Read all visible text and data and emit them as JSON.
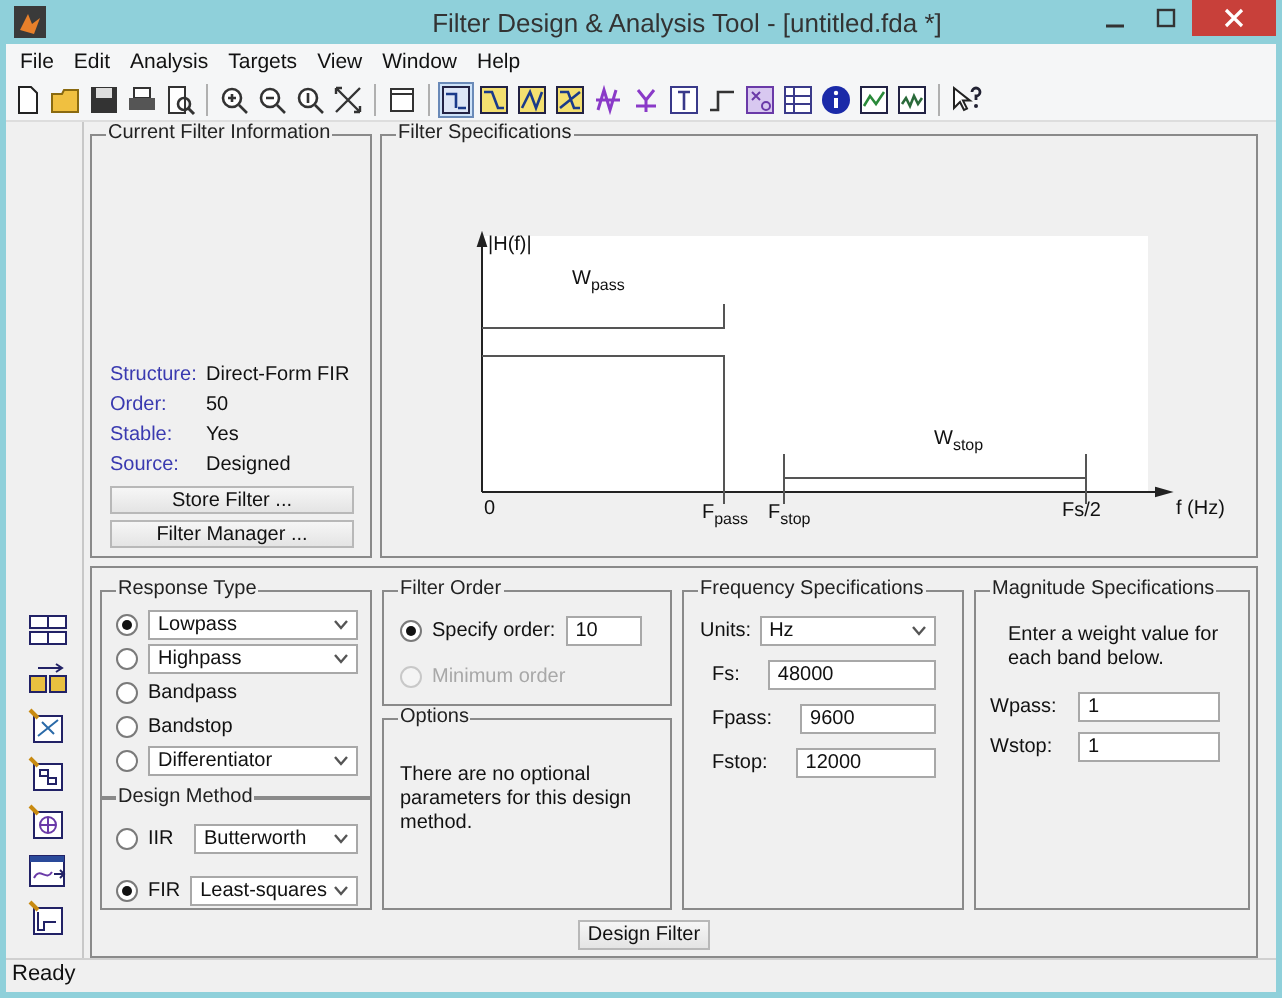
{
  "window": {
    "title": "Filter Design & Analysis Tool -  [untitled.fda *]"
  },
  "menu": [
    "File",
    "Edit",
    "Analysis",
    "Targets",
    "View",
    "Window",
    "Help"
  ],
  "toolbar": {
    "groups": [
      {
        "buttons": [
          {
            "kind": "new",
            "selected": false
          },
          {
            "kind": "open",
            "selected": false
          },
          {
            "kind": "save",
            "selected": false
          },
          {
            "kind": "print",
            "selected": false
          },
          {
            "kind": "preview",
            "selected": false
          }
        ]
      },
      {
        "buttons": [
          {
            "kind": "zoom-in",
            "selected": false
          },
          {
            "kind": "zoom-out",
            "selected": false
          },
          {
            "kind": "zoom-y",
            "selected": false
          },
          {
            "kind": "full-view",
            "selected": false
          }
        ]
      },
      {
        "buttons": [
          {
            "kind": "window",
            "selected": false
          }
        ]
      },
      {
        "buttons": [
          {
            "kind": "spec",
            "selected": true
          },
          {
            "kind": "magnitude",
            "selected": false
          },
          {
            "kind": "phase",
            "selected": false
          },
          {
            "kind": "mag-phase",
            "selected": false
          },
          {
            "kind": "group-delay",
            "selected": false
          },
          {
            "kind": "phase-delay",
            "selected": false
          },
          {
            "kind": "impulse",
            "selected": false
          },
          {
            "kind": "step",
            "selected": false
          },
          {
            "kind": "pole-zero",
            "selected": false
          },
          {
            "kind": "coefficients",
            "selected": false
          },
          {
            "kind": "info",
            "selected": false
          },
          {
            "kind": "round-off",
            "selected": false
          },
          {
            "kind": "noise",
            "selected": false
          }
        ]
      },
      {
        "buttons": [
          {
            "kind": "help",
            "selected": false
          }
        ]
      }
    ]
  },
  "current_filter_information": {
    "title": "Current Filter Information",
    "fields": [
      {
        "label": "Structure:",
        "value": "Direct-Form FIR"
      },
      {
        "label": "Order:",
        "value": "50"
      },
      {
        "label": "Stable:",
        "value": "Yes"
      },
      {
        "label": "Source:",
        "value": "Designed"
      }
    ],
    "buttons": [
      "Store Filter ...",
      "Filter Manager ..."
    ]
  },
  "filter_specifications": {
    "title": "Filter Specifications",
    "labels": {
      "magnitude": "|H(f)|",
      "pass_weight": "W$_{pass}$",
      "stop_weight": "W$_{stop}$",
      "zero": "0",
      "f_pass": "F$_{pass}$",
      "f_stop": "F$_{stop}$",
      "half_fs": "Fs/2",
      "frequency_axis": "f (Hz)"
    }
  },
  "response_type": {
    "title": "Response Type",
    "options": [
      {
        "kind": "dropdown",
        "label": "Lowpass",
        "selected": true
      },
      {
        "kind": "dropdown",
        "label": "Highpass",
        "selected": false
      },
      {
        "kind": "plain",
        "label": "Bandpass",
        "selected": false
      },
      {
        "kind": "plain",
        "label": "Bandstop",
        "selected": false
      },
      {
        "kind": "dropdown",
        "label": "Differentiator",
        "selected": false
      }
    ]
  },
  "design_method": {
    "title": "Design Method",
    "options": [
      {
        "label": "IIR",
        "value": "Butterworth",
        "selected": false
      },
      {
        "label": "FIR",
        "value": "Least-squares",
        "selected": true
      }
    ]
  },
  "filter_order": {
    "title": "Filter Order",
    "options": [
      {
        "kind": "field",
        "label": "Specify order:",
        "value": "10",
        "selected": true,
        "disabled": false
      },
      {
        "kind": "plain",
        "label": "Minimum order",
        "selected": false,
        "disabled": true
      }
    ]
  },
  "options": {
    "title": "Options",
    "text": "There are no optional parameters for this design method."
  },
  "frequency_specifications": {
    "title": "Frequency Specifications",
    "units": {
      "label": "Units:",
      "value": "Hz"
    },
    "fields": [
      {
        "label": "Fs:",
        "value": "48000"
      },
      {
        "label": "Fpass:",
        "value": "9600"
      },
      {
        "label": "Fstop:",
        "value": "12000"
      }
    ]
  },
  "magnitude_specifications": {
    "title": "Magnitude Specifications",
    "text": "Enter a weight value for each band below.",
    "fields": [
      {
        "label": "Wpass:",
        "value": "1"
      },
      {
        "label": "Wstop:",
        "value": "1"
      }
    ]
  },
  "design_button": "Design Filter",
  "status_bar": "Ready"
}
